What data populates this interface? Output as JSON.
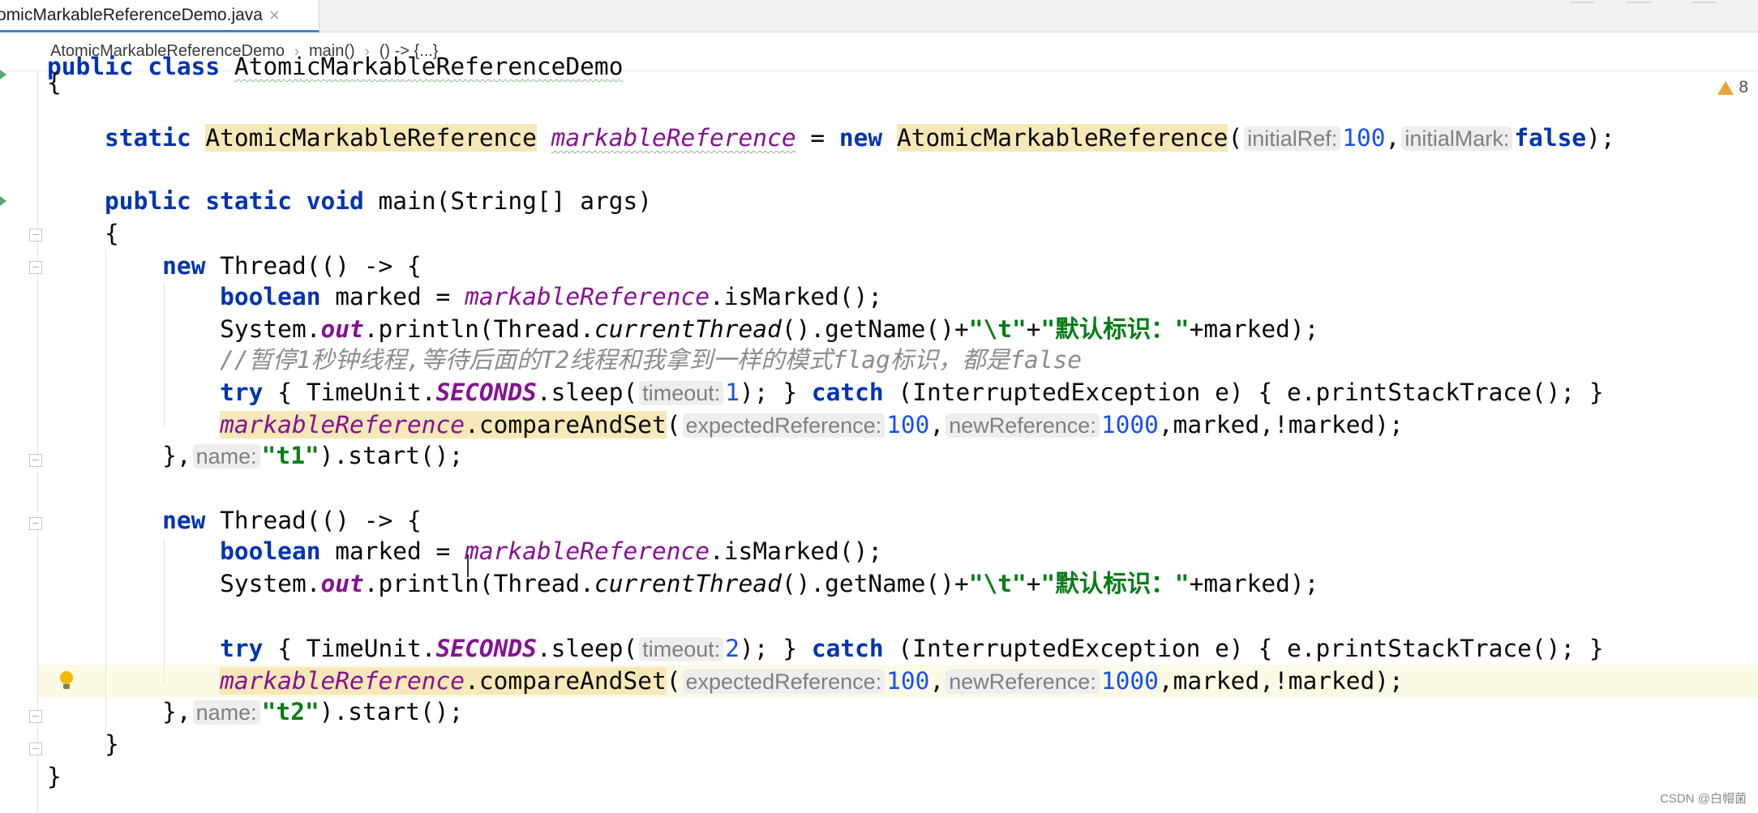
{
  "tab": {
    "label": "omicMarkableReferenceDemo.java",
    "close": "×"
  },
  "breadcrumb": [
    {
      "label": "AtomicMarkableReferenceDemo"
    },
    {
      "label": "main()"
    },
    {
      "label": "() -> {...}"
    }
  ],
  "breadcrumb_sep": "›",
  "inspection": {
    "warning_count": "8"
  },
  "code": {
    "l0": {
      "kw1": "public",
      "kw2": "class",
      "name": "AtomicMarkableReferenceDemo"
    },
    "l1": {
      "brace": "{"
    },
    "l2": {
      "kw": "static",
      "type": "AtomicMarkableReference",
      "field": "markableReference",
      "eq": " = ",
      "kw_new": "new",
      "ctor": "AtomicMarkableReference",
      "open": "(",
      "hint1": "initialRef:",
      "val1": "100",
      "comma": ",",
      "hint2": "initialMark:",
      "val2": "false",
      "close": ");"
    },
    "l4": {
      "kw1": "public",
      "kw2": "static",
      "kw3": "void",
      "rest": "main(String[] args)"
    },
    "l5": {
      "brace": "{"
    },
    "l6": {
      "kw": "new",
      "rest": "Thread(() -> {"
    },
    "l7": {
      "kw": "boolean",
      "mid": "marked = ",
      "field": "markableReference",
      "rest": ".isMarked();"
    },
    "l8": {
      "p1": "System.",
      "out": "out",
      "p2": ".println(Thread.",
      "ct": "currentThread",
      "p3": "().getName()+",
      "s1": "\"\\t\"",
      "plus": "+",
      "s2": "\"默认标识：\"",
      "p4": "+marked);"
    },
    "l9": {
      "comment": "//暂停1秒钟线程,等待后面的T2线程和我拿到一样的模式flag标识，都是false"
    },
    "l10": {
      "kw1": "try",
      "p1": " { TimeUnit.",
      "sec": "SECONDS",
      "p2": ".sleep(",
      "hint": "timeout:",
      "val": "1",
      "p3": "); } ",
      "kw2": "catch",
      "p4": " (InterruptedException e) { e.printStackTrace(); }"
    },
    "l11": {
      "field": "markableReference",
      "call": ".compareAndSet",
      "open": "(",
      "hint1": "expectedReference:",
      "val1": "100",
      "comma": ",",
      "hint2": "newReference:",
      "val2": "1000",
      "rest": ",marked,!marked);"
    },
    "l12": {
      "p1": "},",
      "hint": "name:",
      "str": "\"t1\"",
      "rest": ").start();"
    },
    "l14": {
      "kw": "new",
      "rest": "Thread(() -> {"
    },
    "l15": {
      "kw": "boolean",
      "mid": "marked = ",
      "field": "markableReference",
      "rest": ".isMarked();"
    },
    "l16": {
      "p1": "System.",
      "out": "out",
      "p2": ".println(Thread.",
      "ct": "currentThread",
      "p3": "().getName()+",
      "s1": "\"\\t\"",
      "plus": "+",
      "s2": "\"默认标识：\"",
      "p4": "+marked);"
    },
    "l18": {
      "kw1": "try",
      "p1": " { TimeUnit.",
      "sec": "SECONDS",
      "p2": ".sleep(",
      "hint": "timeout:",
      "val": "2",
      "p3": "); } ",
      "kw2": "catch",
      "p4": " (InterruptedException e) { e.printStackTrace(); }"
    },
    "l19": {
      "field": "markableReference",
      "call": ".compareAndSet",
      "open": "(",
      "hint1": "expectedReference:",
      "val1": "100",
      "comma": ",",
      "hint2": "newReference:",
      "val2": "1000",
      "rest": ",marked,!marked);"
    },
    "l20": {
      "p1": "},",
      "hint": "name:",
      "str": "\"t2\"",
      "rest": ").start();"
    },
    "l21": {
      "brace": "}"
    },
    "l22": {
      "brace": "}"
    }
  },
  "watermark": "CSDN @白帽菌"
}
